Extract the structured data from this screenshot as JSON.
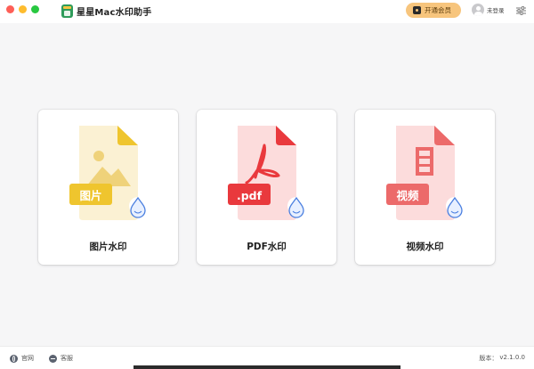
{
  "app": {
    "title": "星星Mac水印助手"
  },
  "header": {
    "vip_label": "开通会员",
    "login_label": "未登录",
    "vip_color": "#f7c57d"
  },
  "cards": [
    {
      "label": "图片水印",
      "badge": "图片",
      "icon": "image-file-icon",
      "accent": "#efc52e"
    },
    {
      "label": "PDF水印",
      "badge": ".pdf",
      "icon": "pdf-file-icon",
      "accent": "#e9393d"
    },
    {
      "label": "视频水印",
      "badge": "视频",
      "icon": "video-file-icon",
      "accent": "#ec6a6a"
    }
  ],
  "footer": {
    "website_label": "官网",
    "support_label": "客服",
    "version_prefix": "版本：",
    "version_value": "v2.1.0.0"
  }
}
